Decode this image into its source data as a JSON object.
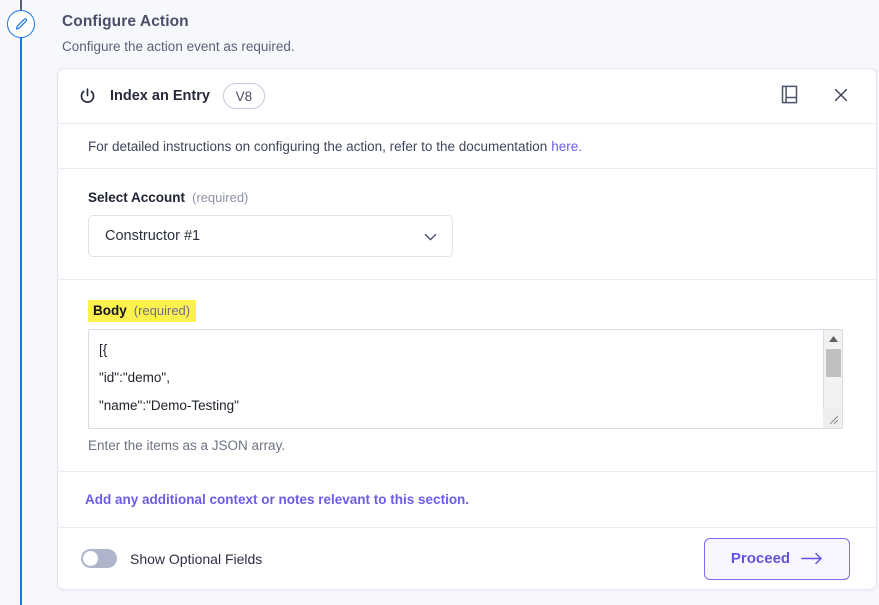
{
  "rail": {
    "icon": "pencil-icon",
    "line_color_top": "#5b6175",
    "line_color_bottom": "#1a73e8"
  },
  "heading": {
    "title": "Configure Action",
    "subtitle": "Configure the action event as required."
  },
  "card": {
    "header": {
      "icon": "power-icon",
      "title": "Index an Entry",
      "version_badge": "V8",
      "docs_icon": "book-icon",
      "close_icon": "close-icon"
    },
    "info": {
      "text": "For detailed instructions on configuring the action, refer to the documentation",
      "link_label": "here.",
      "link_color": "#6b5ce7"
    },
    "account": {
      "label": "Select Account",
      "required_note": "(required)",
      "selected_value": "Constructor #1",
      "chevron_icon": "chevron-down-icon"
    },
    "body_field": {
      "label": "Body",
      "required_note": "(required)",
      "highlight_color": "#fdf14e",
      "value": "[{\n\"id\":\"demo\",\n\"name\":\"Demo-Testing\"\n}",
      "placeholder": "Enter the items as a JSON array.",
      "helper_text": "Enter the items as a JSON array.",
      "scrollbar": {
        "up_arrow": "scroll-up-arrow-icon",
        "down_arrow": "scroll-down-arrow-icon",
        "resize_grip": "resize-grip-icon"
      }
    },
    "notes": {
      "link_label": "Add any additional context or notes relevant to this section."
    },
    "footer": {
      "toggle_label": "Show Optional Fields",
      "toggle_state": "off",
      "proceed_label": "Proceed",
      "proceed_arrow_icon": "arrow-right-icon",
      "accent_color": "#6254e0"
    }
  }
}
